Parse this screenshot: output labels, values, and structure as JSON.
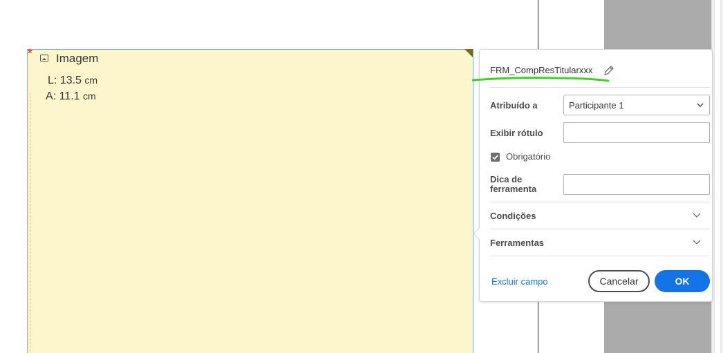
{
  "image_field": {
    "required_marker": "*",
    "title": "Imagem",
    "icon": "image-icon",
    "width_label": "L:",
    "width_value": "13.5",
    "width_unit": "cm",
    "height_label": "A:",
    "height_value": "11.1",
    "height_unit": "cm"
  },
  "properties_panel": {
    "field_name": "FRM_CompResTitularxxx",
    "edit_icon": "pencil-icon",
    "assigned_to": {
      "label": "Atribuído a",
      "value": "Participante 1"
    },
    "display_label": {
      "label": "Exibir rótulo",
      "value": ""
    },
    "required": {
      "label": "Obrigatório",
      "checked": true
    },
    "tooltip": {
      "label_line1": "Dica de",
      "label_line2": "ferramenta",
      "value": ""
    },
    "sections": [
      {
        "label": "Condições"
      },
      {
        "label": "Ferramentas"
      }
    ],
    "delete_link": "Excluir campo",
    "cancel_label": "Cancelar",
    "ok_label": "OK"
  },
  "colors": {
    "field_background": "#fdf5cc",
    "accent_blue": "#1473e6",
    "highlight_green": "#3ad61e",
    "required_red": "#e8422e"
  }
}
